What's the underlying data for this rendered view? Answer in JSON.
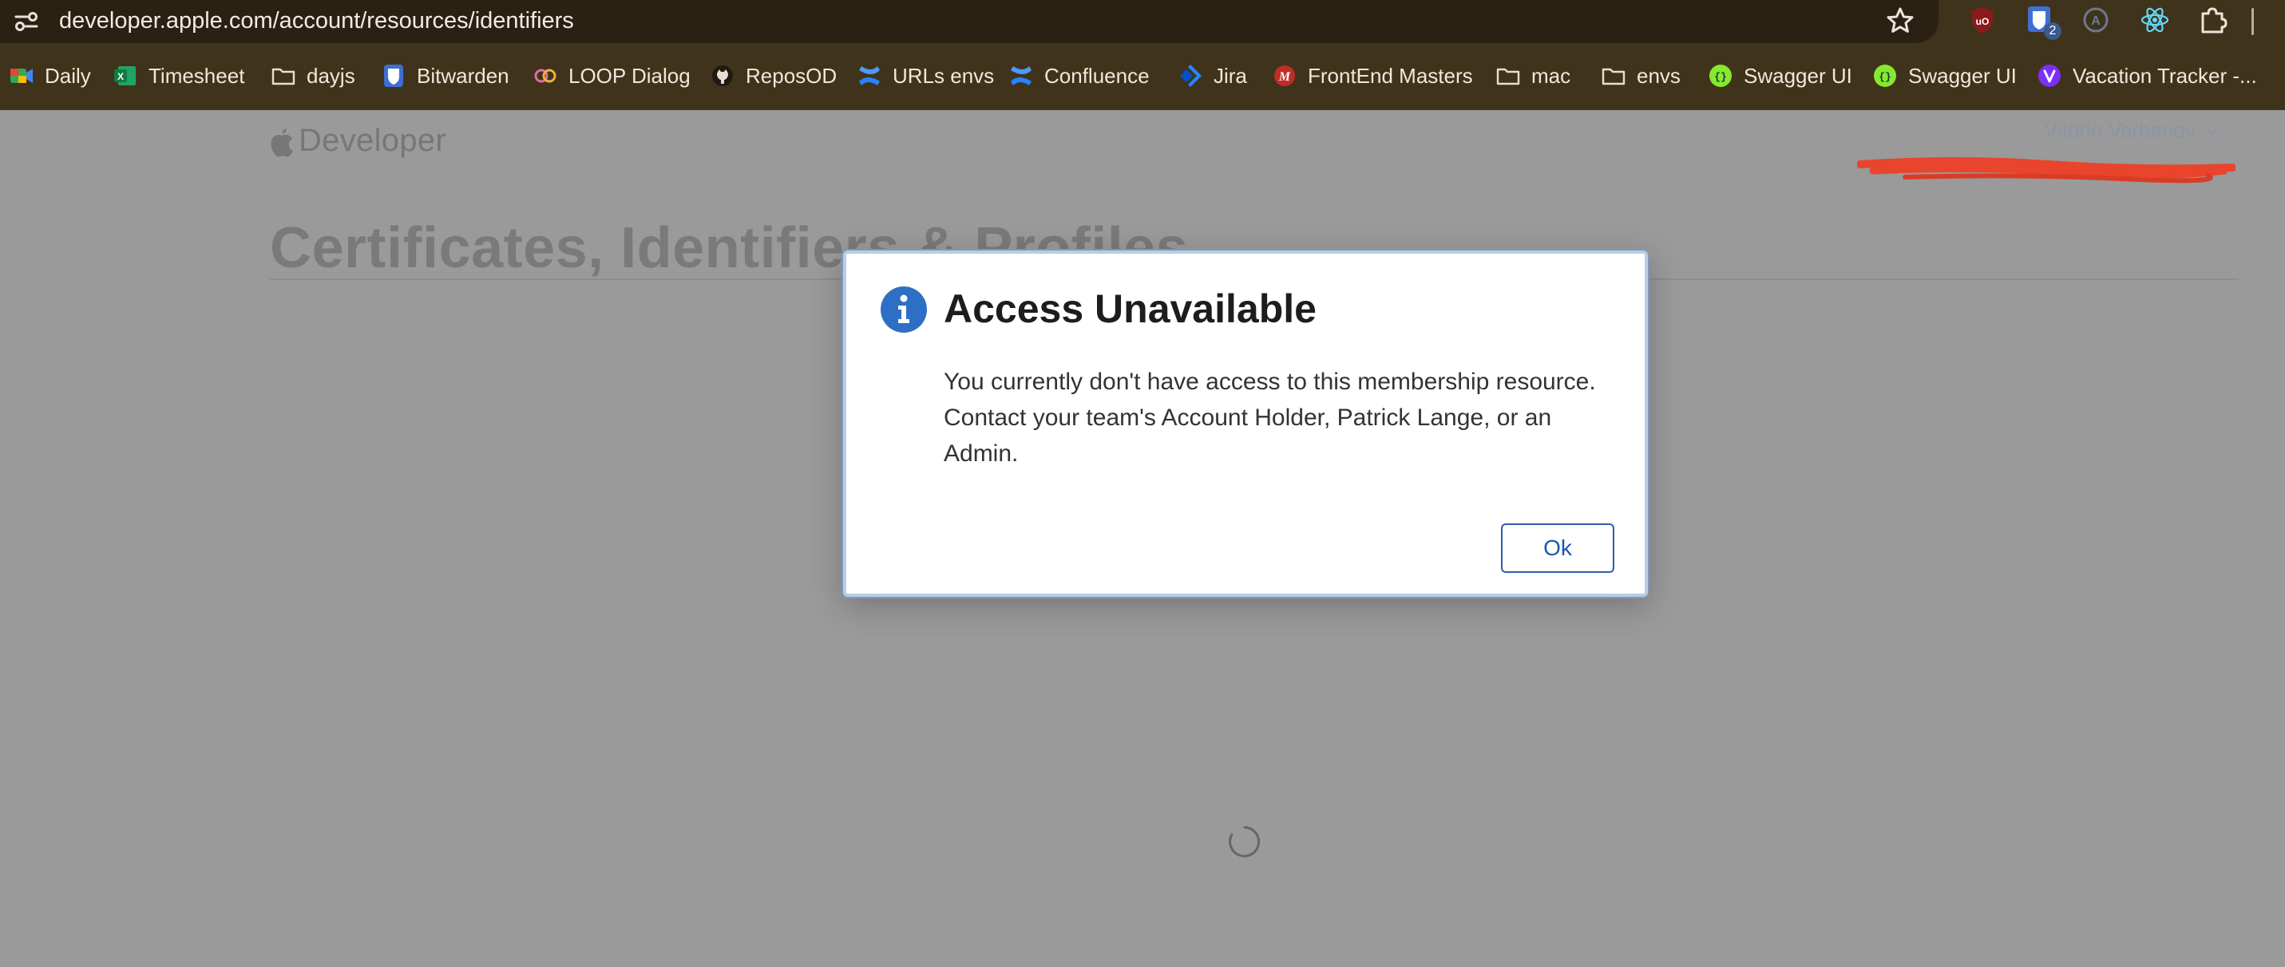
{
  "browser": {
    "url": "developer.apple.com/account/resources/identifiers",
    "icons": {
      "site_info": "site-settings-icon",
      "bookmark_star": "star-icon"
    },
    "extensions": [
      {
        "name": "ublock-icon",
        "badge": ""
      },
      {
        "name": "bitwarden-extension-icon",
        "badge": "2"
      },
      {
        "name": "account-extension-icon",
        "badge": ""
      },
      {
        "name": "react-devtools-icon",
        "badge": ""
      },
      {
        "name": "extensions-puzzle-icon",
        "badge": ""
      }
    ],
    "bookmarks": [
      {
        "label": "Daily",
        "icon": "google-meet-icon"
      },
      {
        "label": "Timesheet",
        "icon": "excel-icon"
      },
      {
        "label": "dayjs",
        "icon": "folder-icon"
      },
      {
        "label": "Bitwarden",
        "icon": "bitwarden-icon"
      },
      {
        "label": "LOOP Dialog",
        "icon": "loop-icon"
      },
      {
        "label": "ReposOD",
        "icon": "github-icon"
      },
      {
        "label": "URLs envs",
        "icon": "confluence-icon"
      },
      {
        "label": "Confluence",
        "icon": "confluence-icon"
      },
      {
        "label": "Jira",
        "icon": "jira-icon"
      },
      {
        "label": "FrontEnd Masters",
        "icon": "frontend-masters-icon"
      },
      {
        "label": "mac",
        "icon": "folder-icon"
      },
      {
        "label": "envs",
        "icon": "folder-icon"
      },
      {
        "label": "Swagger UI",
        "icon": "swagger-icon"
      },
      {
        "label": "Swagger UI",
        "icon": "swagger-icon"
      },
      {
        "label": "Vacation Tracker -...",
        "icon": "vacation-tracker-icon"
      }
    ]
  },
  "page": {
    "brand": "Developer",
    "user_name": "Vitorio Varbanov",
    "title": "Certificates, Identifiers & Profiles"
  },
  "dialog": {
    "title": "Access Unavailable",
    "line1": "You currently don't have access to this membership resource.",
    "line2": "Contact your team's Account Holder, Patrick Lange, or an",
    "line3": "Admin.",
    "ok_label": "Ok"
  },
  "colors": {
    "chrome_bg": "#40331c",
    "omnibox_bg": "#2a2113",
    "overlay_bg": "#9a9a9a",
    "dialog_accent": "#2b5ea8",
    "info_icon": "#2d6fc4",
    "redaction": "#e8452c"
  }
}
